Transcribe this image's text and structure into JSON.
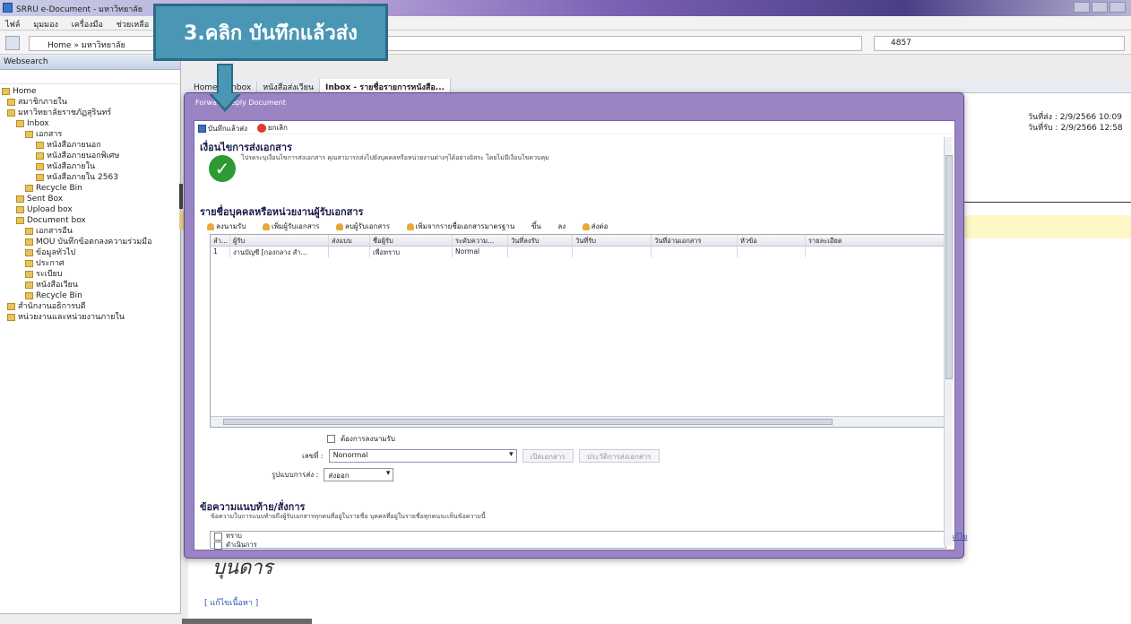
{
  "window": {
    "title": "SRRU e-Document - มหาวิทยาลัย",
    "controls": [
      "minimize",
      "maximize",
      "close"
    ]
  },
  "menubar": [
    "ไฟล์",
    "มุมมอง",
    "เครื่องมือ",
    "ช่วยเหลือ"
  ],
  "address": {
    "breadcrumb": "Home » มหาวิทยาลัย",
    "search_value": "4857"
  },
  "sidebar": {
    "title": "Websearch",
    "tree": [
      "Home",
      "สมาชิกภายใน",
      "มหาวิทยาลัยราชภัฏสุรินทร์",
      "Inbox",
      "เอกสาร",
      "หนังสือภายนอก",
      "หนังสือภายนอกพิเศษ",
      "หนังสือภายใน",
      "หนังสือภายใน 2563",
      "Recycle Bin",
      "Sent Box",
      "Upload box",
      "Document box",
      "เอกสารอื่น",
      "MOU บันทึกข้อตกลงความร่วมมือ",
      "ข้อมูลทั่วไป",
      "ประกาศ",
      "ระเบียบ",
      "หนังสือเวียน",
      "Recycle Bin",
      "สำนักงานอธิการบดี",
      "หน่วยงานและหน่วยงานภายใน"
    ]
  },
  "tabs": [
    "Home",
    "Inbox",
    "หนังสือส่งเวียน",
    "Inbox - รายชื่อรายการหนังสือ..."
  ],
  "header_dates": {
    "sent": "วันที่ส่ง : 2/9/2566 10:09",
    "received": "วันที่รับ : 2/9/2566 12:58"
  },
  "modal": {
    "title": "Forward Reply Document",
    "toolbar": {
      "save_send": "บันทึกแล้วส่ง",
      "cancel": "ยกเลิก"
    },
    "send_section": {
      "title": "เงื่อนไขการส่งเอกสาร",
      "description": "โปรดระบุเงื่อนไขการส่งเอกสาร คุณสามารถส่งไปยังบุคคลหรือหน่วยงานต่างๆได้อย่างอิสระ โดยไม่มีเงื่อนไขควบคุม"
    },
    "recipients": {
      "title": "รายชื่อบุคคลหรือหน่วยงานผู้รับเอกสาร",
      "toolbar": [
        "ลงนามรับ",
        "เพิ่มผู้รับเอกสาร",
        "ลบผู้รับเอกสาร",
        "เพิ่มจากรายชื่อเอกสารมาตรฐาน",
        "ขึ้น",
        "ลง",
        "ส่งต่อ"
      ],
      "columns": [
        "ลำ...",
        "ผู้รับ",
        "ส่งแบบ",
        "ชื่อผู้รับ",
        "ระดับความ...",
        "วันที่ลงรับ",
        "วันที่รับ",
        "วันที่อ่านเอกสาร",
        "หัวข้อ",
        "รายละเอียด"
      ],
      "rows": [
        [
          "1",
          "งานบัญชี [กองกลาง สำ...",
          "",
          "เพื่อทราบ",
          "Normal",
          "",
          "",
          "",
          "",
          ""
        ]
      ]
    },
    "options": {
      "require_signature_label": "ต้องการลงนามรับ",
      "priority_label": "เลขที่ :",
      "priority_value": "Nonormal",
      "btn_browse": "เปิดเอกสาร",
      "btn_history": "ประวัติการส่งเอกสาร",
      "send_type_label": "รูปแบบการส่ง :",
      "send_type_value": "ส่งออก"
    },
    "memo": {
      "title": "ข้อความแนบท้าย/สั่งการ",
      "description": "ข้อความในการแนบท้ายถึงผู้รับเอกสารทุกคนที่อยู่ในรายชื่อ บุคคลที่อยู่ในรายชื่อทุกคนจะเห็นข้อความนี้",
      "lines": [
        "ทราบ",
        "ดำเนินการ"
      ],
      "edit_link": "แก้ไข"
    }
  },
  "signature_text": "บุนดาร",
  "attach_link": "[ แก้ไขเนื้อหา ]",
  "callout": {
    "text": "3.คลิก บันทึกแล้วส่ง"
  }
}
